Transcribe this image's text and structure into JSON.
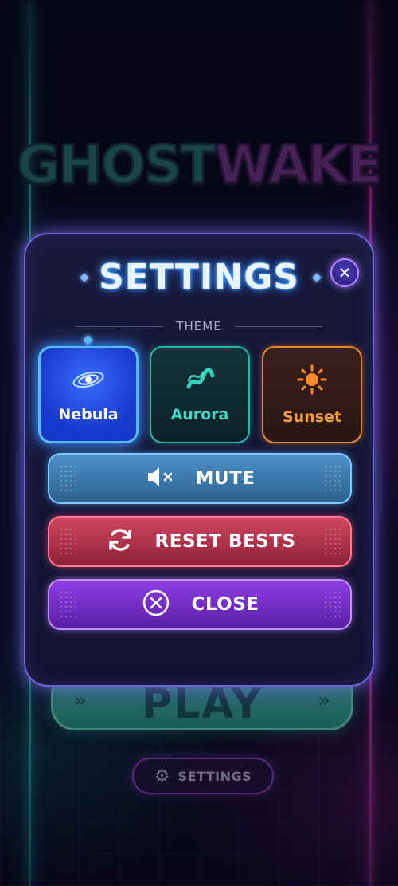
{
  "background": {
    "logo": {
      "part1": "GHOST",
      "part2": "WAKE"
    },
    "play_button": {
      "label": "PLAY",
      "chevron_left": "»",
      "chevron_right": "»"
    },
    "settings_button": {
      "icon": "gear-icon",
      "label": "SETTINGS"
    }
  },
  "modal": {
    "title": "SETTINGS",
    "close_icon": "close-icon",
    "theme_section_label": "THEME",
    "themes": [
      {
        "label": "Nebula",
        "icon": "galaxy-icon",
        "selected": true,
        "accent": "#3b8cff"
      },
      {
        "label": "Aurora",
        "icon": "aurora-wave-icon",
        "selected": false,
        "accent": "#2fd3bc"
      },
      {
        "label": "Sunset",
        "icon": "sun-icon",
        "selected": false,
        "accent": "#ff8a2a"
      }
    ],
    "actions": [
      {
        "label": "MUTE",
        "icon": "speaker-muted-icon",
        "color": "#3f7fb4"
      },
      {
        "label": "RESET BESTS",
        "icon": "refresh-icon",
        "color": "#b8374f"
      },
      {
        "label": "CLOSE",
        "icon": "close-circle-icon",
        "color": "#7a30cc"
      }
    ]
  },
  "colors": {
    "neon_cyan": "#3be0d6",
    "neon_magenta": "#e644c8",
    "modal_border": "#6e64d8"
  }
}
